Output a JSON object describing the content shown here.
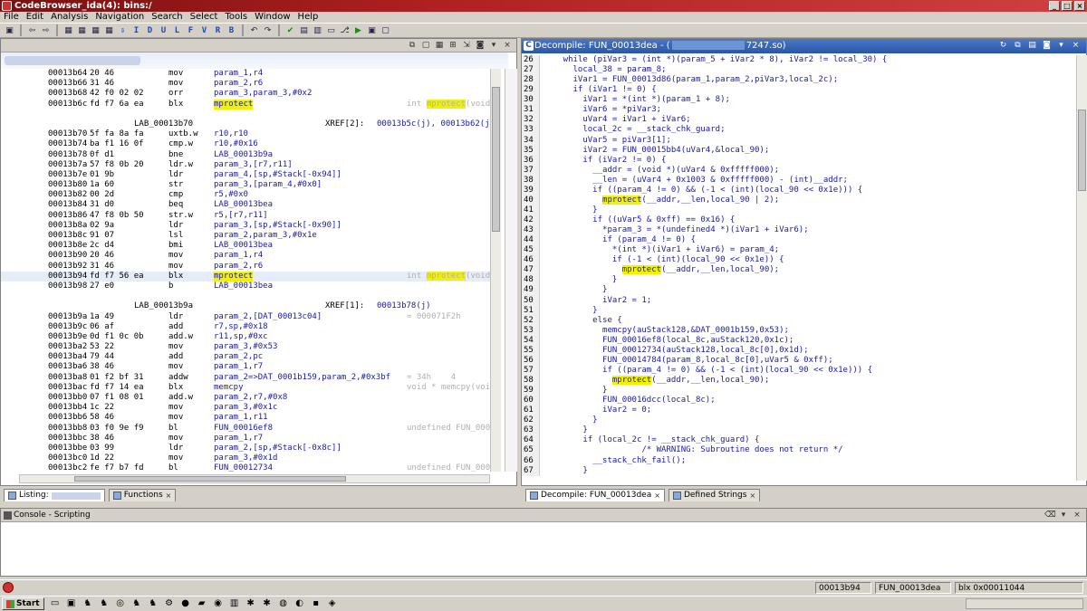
{
  "window": {
    "title": "CodeBrowser_ida(4): bins:/"
  },
  "menu": [
    "File",
    "Edit",
    "Analysis",
    "Navigation",
    "Search",
    "Select",
    "Tools",
    "Window",
    "Help"
  ],
  "toolbar_icons": [
    "save-icon",
    "back-icon",
    "forward-icon",
    "nav-icon",
    "nav-icon",
    "nav-icon",
    "nav-icon",
    "down-arrow-icon",
    "I",
    "D",
    "U",
    "L",
    "F",
    "V",
    "R",
    "B",
    "undo-icon",
    "redo-icon",
    "check-icon",
    "run-icon"
  ],
  "listing": {
    "rows": [
      {
        "addr": "00013b64",
        "bytes": "20 46",
        "mn": "mov",
        "op": "param_1,r4"
      },
      {
        "addr": "00013b66",
        "bytes": "31 46",
        "mn": "mov",
        "op": "param_2,r6"
      },
      {
        "addr": "00013b68",
        "bytes": "42 f0 02 02",
        "mn": "orr",
        "op": "param_3,param_3,#0x2"
      },
      {
        "addr": "00013b6c",
        "bytes": "fd f7 6a ea",
        "mn": "blx",
        "op": "mprotect",
        "hlop": true,
        "cm_pre": "int ",
        "cm_hl": "mprotect",
        "cm_post": "(void *"
      },
      {
        "blank": true
      },
      {
        "label": "LAB_00013b70",
        "xref": "XREF[2]:",
        "xrefv": "00013b5c(j), 00013b62(j)"
      },
      {
        "addr": "00013b70",
        "bytes": "5f fa 8a fa",
        "mn": "uxtb.w",
        "op": "r10,r10"
      },
      {
        "addr": "00013b74",
        "bytes": "ba f1 16 0f",
        "mn": "cmp.w",
        "op": "r10,#0x16"
      },
      {
        "addr": "00013b78",
        "bytes": "0f d1",
        "mn": "bne",
        "op": "LAB_00013b9a"
      },
      {
        "addr": "00013b7a",
        "bytes": "57 f8 0b 20",
        "mn": "ldr.w",
        "op": "param_3,[r7,r11]"
      },
      {
        "addr": "00013b7e",
        "bytes": "01 9b",
        "mn": "ldr",
        "op": "param_4,[sp,#Stack[-0x94]]"
      },
      {
        "addr": "00013b80",
        "bytes": "1a 60",
        "mn": "str",
        "op": "param_3,[param_4,#0x0]"
      },
      {
        "addr": "00013b82",
        "bytes": "00 2d",
        "mn": "cmp",
        "op": "r5,#0x0"
      },
      {
        "addr": "00013b84",
        "bytes": "31 d0",
        "mn": "beq",
        "op": "LAB_00013bea"
      },
      {
        "addr": "00013b86",
        "bytes": "47 f8 0b 50",
        "mn": "str.w",
        "op": "r5,[r7,r11]"
      },
      {
        "addr": "00013b8a",
        "bytes": "02 9a",
        "mn": "ldr",
        "op": "param_3,[sp,#Stack[-0x90]]"
      },
      {
        "addr": "00013b8c",
        "bytes": "91 07",
        "mn": "lsl",
        "op": "param_2,param_3,#0x1e"
      },
      {
        "addr": "00013b8e",
        "bytes": "2c d4",
        "mn": "bmi",
        "op": "LAB_00013bea"
      },
      {
        "addr": "00013b90",
        "bytes": "20 46",
        "mn": "mov",
        "op": "param_1,r4"
      },
      {
        "addr": "00013b92",
        "bytes": "31 46",
        "mn": "mov",
        "op": "param_2,r6"
      },
      {
        "addr": "00013b94",
        "bytes": "fd f7 56 ea",
        "mn": "blx",
        "op": "mprotect",
        "hlop": true,
        "sel": true,
        "cm_pre": "int ",
        "cm_hl": "mprotect",
        "cm_post": "(void *"
      },
      {
        "addr": "00013b98",
        "bytes": "27 e0",
        "mn": "b",
        "op": "LAB_00013bea"
      },
      {
        "blank": true
      },
      {
        "label": "LAB_00013b9a",
        "xref": "XREF[1]:",
        "xrefv": "00013b78(j)"
      },
      {
        "addr": "00013b9a",
        "bytes": "1a 49",
        "mn": "ldr",
        "op": "param_2,[DAT_00013c04]",
        "cm_pre": "= 000071F2h"
      },
      {
        "addr": "00013b9c",
        "bytes": "06 af",
        "mn": "add",
        "op": "r7,sp,#0x18"
      },
      {
        "addr": "00013b9e",
        "bytes": "0d f1 0c 0b",
        "mn": "add.w",
        "op": "r11,sp,#0xc"
      },
      {
        "addr": "00013ba2",
        "bytes": "53 22",
        "mn": "mov",
        "op": "param_3,#0x53"
      },
      {
        "addr": "00013ba4",
        "bytes": "79 44",
        "mn": "add",
        "op": "param_2,pc"
      },
      {
        "addr": "00013ba6",
        "bytes": "38 46",
        "mn": "mov",
        "op": "param_1,r7"
      },
      {
        "addr": "00013ba8",
        "bytes": "01 f2 bf 31",
        "mn": "addw",
        "op": "param_2=>DAT_0001b159,param_2,#0x3bf",
        "cm_pre": "= 34h    4"
      },
      {
        "addr": "00013bac",
        "bytes": "fd f7 14 ea",
        "mn": "blx",
        "op": "memcpy",
        "cm_pre": "void * memcpy(void"
      },
      {
        "addr": "00013bb0",
        "bytes": "07 f1 08 01",
        "mn": "add.w",
        "op": "param_2,r7,#0x8"
      },
      {
        "addr": "00013bb4",
        "bytes": "1c 22",
        "mn": "mov",
        "op": "param_3,#0x1c"
      },
      {
        "addr": "00013bb6",
        "bytes": "58 46",
        "mn": "mov",
        "op": "param_1,r11"
      },
      {
        "addr": "00013bb8",
        "bytes": "03 f0 9e f9",
        "mn": "bl",
        "op": "FUN_00016ef8",
        "cm_pre": "undefined FUN_0001€"
      },
      {
        "addr": "00013bbc",
        "bytes": "38 46",
        "mn": "mov",
        "op": "param_1,r7"
      },
      {
        "addr": "00013bbe",
        "bytes": "03 99",
        "mn": "ldr",
        "op": "param_2,[sp,#Stack[-0x8c]]"
      },
      {
        "addr": "00013bc0",
        "bytes": "1d 22",
        "mn": "mov",
        "op": "param_3,#0x1d"
      },
      {
        "addr": "00013bc2",
        "bytes": "fe f7 b7 fd",
        "mn": "bl",
        "op": "FUN_00012734",
        "cm_pre": "undefined FUN_00012"
      }
    ]
  },
  "decompile": {
    "title_prefix": "Decompile: FUN_00013dea - (",
    "title_suffix": "7247.so)",
    "lines": [
      {
        "n": "26",
        "t": "    while (piVar3 = (int *)(param_5 + iVar2 * 8), iVar2 != local_30) {"
      },
      {
        "n": "27",
        "t": "      local_38 = param_8;"
      },
      {
        "n": "28",
        "t": "      iVar1 = FUN_00013d86(param_1,param_2,piVar3,local_2c);"
      },
      {
        "n": "29",
        "t": "      if (iVar1 != 0) {"
      },
      {
        "n": "30",
        "t": "        iVar1 = *(int *)(param_1 + 8);"
      },
      {
        "n": "31",
        "t": "        iVar6 = *piVar3;"
      },
      {
        "n": "32",
        "t": "        uVar4 = iVar1 + iVar6;"
      },
      {
        "n": "33",
        "t": "        local_2c = __stack_chk_guard;"
      },
      {
        "n": "34",
        "t": "        uVar5 = piVar3[1];"
      },
      {
        "n": "35",
        "t": "        iVar2 = FUN_00015bb4(uVar4,&local_90);"
      },
      {
        "n": "36",
        "t": "        if (iVar2 != 0) {"
      },
      {
        "n": "37",
        "t": "          __addr = (void *)(uVar4 & 0xfffff000);"
      },
      {
        "n": "38",
        "t": "          __len = (uVar4 + 0x1003 & 0xfffff000) - (int)__addr;"
      },
      {
        "n": "39",
        "t": "          if ((param_4 != 0) && (-1 < (int)(local_90 << 0x1e))) {"
      },
      {
        "n": "40",
        "t": "            ",
        "hl": "mprotect",
        "post": "(__addr,__len,local_90 | 2);"
      },
      {
        "n": "41",
        "t": "          }"
      },
      {
        "n": "42",
        "t": "          if ((uVar5 & 0xff) == 0x16) {"
      },
      {
        "n": "43",
        "t": "            *param_3 = *(undefined4 *)(iVar1 + iVar6);"
      },
      {
        "n": "44",
        "t": "            if (param_4 != 0) {"
      },
      {
        "n": "45",
        "t": "              *(int *)(iVar1 + iVar6) = param_4;"
      },
      {
        "n": "46",
        "t": "              if (-1 < (int)(local_90 << 0x1e)) {"
      },
      {
        "n": "47",
        "t": "                ",
        "hl": "mprotect",
        "post": "(__addr,__len,local_90);"
      },
      {
        "n": "48",
        "t": "              }"
      },
      {
        "n": "49",
        "t": "            }"
      },
      {
        "n": "50",
        "t": "            iVar2 = 1;"
      },
      {
        "n": "51",
        "t": "          }"
      },
      {
        "n": "52",
        "t": "          else {"
      },
      {
        "n": "53",
        "t": "            memcpy(auStack128,&DAT_0001b159,0x53);"
      },
      {
        "n": "54",
        "t": "            FUN_00016ef8(local_8c,auStack120,0x1c);"
      },
      {
        "n": "55",
        "t": "            FUN_00012734(auStack128,local_8c[0],0x1d);"
      },
      {
        "n": "56",
        "t": "            FUN_00014784(param_8,local_8c[0],uVar5 & 0xff);"
      },
      {
        "n": "57",
        "t": "            if ((param_4 != 0) && (-1 < (int)(local_90 << 0x1e))) {"
      },
      {
        "n": "58",
        "t": "              ",
        "hl": "mprotect",
        "post": "(__addr,__len,local_90);"
      },
      {
        "n": "59",
        "t": "            }"
      },
      {
        "n": "60",
        "t": "            FUN_00016dcc(local_8c);"
      },
      {
        "n": "61",
        "t": "            iVar2 = 0;"
      },
      {
        "n": "62",
        "t": "          }"
      },
      {
        "n": "63",
        "t": "        }"
      },
      {
        "n": "64",
        "t": "        if (local_2c != __stack_chk_guard) {"
      },
      {
        "n": "65",
        "t": "                    /* WARNING: Subroutine does not return */"
      },
      {
        "n": "66",
        "t": "          __stack_chk_fail();"
      },
      {
        "n": "67",
        "t": "        }"
      }
    ]
  },
  "tabs": {
    "listing": "Listing:",
    "functions": "Functions",
    "decompile": "Decompile: FUN_00013dea",
    "defined_strings": "Defined Strings",
    "close": "×"
  },
  "console": {
    "title": "Console - Scripting"
  },
  "status": {
    "address": "00013b94",
    "function": "FUN_00013dea",
    "instruction": "blx 0x00011044"
  },
  "taskbar": {
    "start": "Start"
  }
}
